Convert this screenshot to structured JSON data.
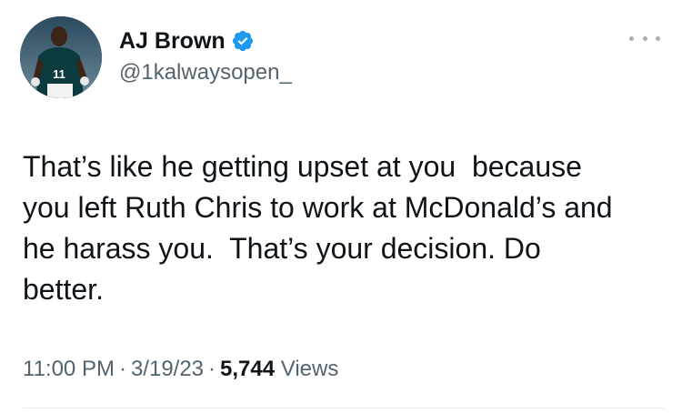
{
  "author": {
    "display_name": "AJ Brown",
    "handle": "@1kalwaysopen_",
    "jersey_number": "11",
    "verified": true
  },
  "tweet": {
    "text": "That’s like he getting upset at you  because\nyou left Ruth Chris to work at McDonald’s and\nhe harass you.  That’s your decision. Do\nbetter."
  },
  "meta": {
    "time": "11:00 PM",
    "separator": "·",
    "date": "3/19/23",
    "views_count": "5,744",
    "views_label": "Views"
  },
  "colors": {
    "verified_badge": "#1d9bf0",
    "secondary_text": "#536471",
    "primary_text": "#0f1419"
  },
  "icons": {
    "verified": "verified-badge-icon",
    "more": "more-options-icon"
  }
}
